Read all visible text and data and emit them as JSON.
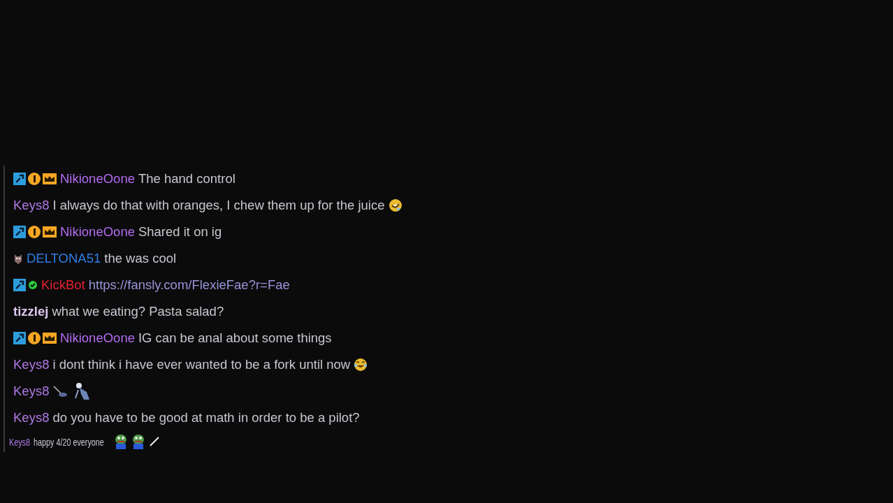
{
  "messages": [
    {
      "kind": "normal",
      "user": "NikioneOone",
      "color": "#b36cf0",
      "badges": [
        {
          "kind": "moderator"
        },
        {
          "kind": "subscriber"
        },
        {
          "kind": "crown"
        }
      ],
      "text": "The hand control"
    },
    {
      "kind": "normal",
      "user": "Keys8",
      "color": "#b07ae6",
      "text": "I always do that with oranges, I chew them up for the juice",
      "emotes": [
        {
          "kind": "rofl"
        }
      ]
    },
    {
      "kind": "normal",
      "user": "NikioneOone",
      "color": "#b36cf0",
      "badges": [
        {
          "kind": "moderator"
        },
        {
          "kind": "subscriber"
        },
        {
          "kind": "crown"
        }
      ],
      "text": "Shared it on ig"
    },
    {
      "kind": "normal",
      "user": "DELTONA51",
      "color": "#2f7ee6",
      "badges": [
        {
          "kind": "mask"
        }
      ],
      "text": "the was cool"
    },
    {
      "kind": "link",
      "user": "KickBot",
      "color": "#e8202f",
      "badges": [
        {
          "kind": "moderator"
        },
        {
          "kind": "verified"
        }
      ],
      "text": "https://fansly.com/FlexieFae?r=Fae"
    },
    {
      "kind": "normal",
      "user": "tizzlej",
      "color": "#dcc9ee",
      "text": "what we eating? Pasta salad?"
    },
    {
      "kind": "normal",
      "user": "NikioneOone",
      "color": "#b36cf0",
      "badges": [
        {
          "kind": "moderator"
        },
        {
          "kind": "subscriber"
        },
        {
          "kind": "crown"
        }
      ],
      "text": "IG can be anal about some things"
    },
    {
      "kind": "normal",
      "user": "Keys8",
      "color": "#b07ae6",
      "text": "i dont think i have ever wanted to be a fork until now",
      "emotes": [
        {
          "kind": "joy"
        }
      ]
    },
    {
      "kind": "normal",
      "user": "Keys8",
      "color": "#b07ae6",
      "emotes": [
        {
          "kind": "sweep"
        },
        {
          "kind": "figure"
        }
      ]
    },
    {
      "kind": "normal",
      "user": "Keys8",
      "color": "#b07ae6",
      "text": "do you have to be good at math in order to be a pilot?"
    },
    {
      "kind": "condensed",
      "user": "Keys8",
      "color": "#b07ae6",
      "text": "happy 4/20 everyone",
      "emotes": [
        {
          "kind": "frog"
        },
        {
          "kind": "frog"
        },
        {
          "kind": "wand"
        }
      ]
    }
  ]
}
